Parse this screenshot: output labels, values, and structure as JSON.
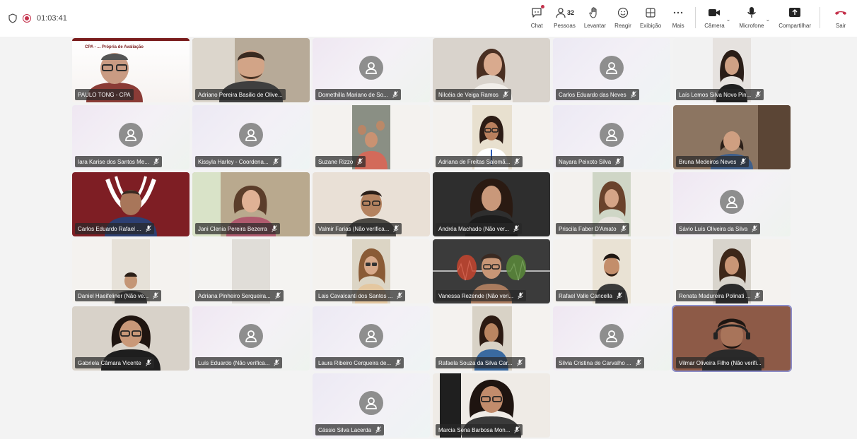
{
  "toolbar": {
    "timer": "01:03:41",
    "chat_label": "Chat",
    "people_label": "Pessoas",
    "people_count": "32",
    "raise_label": "Levantar",
    "react_label": "Reagir",
    "view_label": "Exibição",
    "more_label": "Mais",
    "camera_label": "Câmera",
    "mic_label": "Microfone",
    "share_label": "Compartilhar",
    "leave_label": "Sair"
  },
  "colors": {
    "accent": "#5b5fc7",
    "record": "#c4314b",
    "leave": "#c4314b",
    "avatar": "#8e8e8e"
  },
  "participants": [
    {
      "name": "PAULO TONG - CPA",
      "overlay_text": "CPA - ... Própria de Avaliação"
    },
    {
      "name": "Adriano Pereira Basilio de Olive..."
    },
    {
      "name": "Domethilla Mariano de So..."
    },
    {
      "name": "Nilcéia de Veiga Ramos"
    },
    {
      "name": "Carlos Eduardo das Neves"
    },
    {
      "name": "Laís Lemos Silva Novo Pin..."
    },
    {
      "name": "Iara Karise dos Santos Me..."
    },
    {
      "name": "Kissyla Harley - Coordena..."
    },
    {
      "name": "Suzane Rizzo"
    },
    {
      "name": "Adriana de Freitas Salomã..."
    },
    {
      "name": "Nayara Peixoto Silva"
    },
    {
      "name": "Bruna Medeiros Neves"
    },
    {
      "name": "Carlos Eduardo Rafael ..."
    },
    {
      "name": "Jani Clenia Pereira Bezerra"
    },
    {
      "name": "Valmir Farias (Não verifica..."
    },
    {
      "name": "Andréa Machado (Não ver..."
    },
    {
      "name": "Priscila Faber D'Amato"
    },
    {
      "name": "Sávio Luís Oliveira da Silva"
    },
    {
      "name": "Daniel Haeifeliner (Não ve..."
    },
    {
      "name": "Adriana Pinheiro Serqueira..."
    },
    {
      "name": "Lais Cavalcanti dos Santos ..."
    },
    {
      "name": "Vanessa Rezende (Não veri..."
    },
    {
      "name": "Rafael Valle Cancella"
    },
    {
      "name": "Renata Madureira Polinati ..."
    },
    {
      "name": "Gabriela Câmara Vicente"
    },
    {
      "name": "Luís Eduardo (Não verifica..."
    },
    {
      "name": "Laura Ribeiro Cerqueira de..."
    },
    {
      "name": "Rafaela Souza da Silva Car..."
    },
    {
      "name": "Silvia Cristina de Carvalho ..."
    },
    {
      "name": "Vilmar Oliveira Filho (Não verifi..."
    },
    {
      "name": "Cássio Silva Lacerda"
    },
    {
      "name": "Marcia Sena Barbosa Mon..."
    }
  ]
}
